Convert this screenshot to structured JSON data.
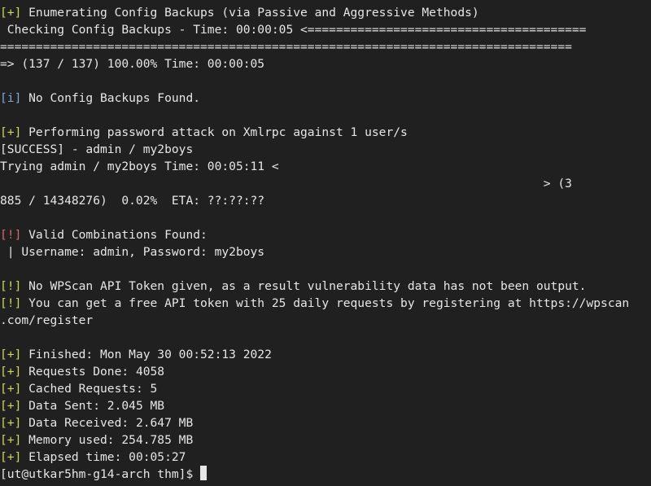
{
  "terminal": {
    "lines": [
      {
        "prefix": "[+]",
        "text": " Enumerating Config Backups (via Passive and Aggressive Methods)"
      },
      {
        "prefix": "",
        "text": " Checking Config Backups - Time: 00:00:05 <======================================="
      },
      {
        "prefix": "",
        "text": "================================================================================"
      },
      {
        "prefix": "",
        "text": "=> (137 / 137) 100.00% Time: 00:00:05"
      },
      {
        "prefix": "",
        "text": ""
      },
      {
        "prefix": "[i]",
        "text": " No Config Backups Found."
      },
      {
        "prefix": "",
        "text": ""
      },
      {
        "prefix": "[+]",
        "text": " Performing password attack on Xmlrpc against 1 user/s"
      },
      {
        "prefix": "",
        "text": "[SUCCESS] - admin / my2boys"
      },
      {
        "prefix": "",
        "text": "Trying admin / my2boys Time: 00:05:11 <"
      },
      {
        "prefix": "",
        "text": "                                                                            > (3"
      },
      {
        "prefix": "",
        "text": "885 / 14348276)  0.02%  ETA: ??:??:??"
      },
      {
        "prefix": "",
        "text": ""
      },
      {
        "prefix": "[!]",
        "text": " Valid Combinations Found:"
      },
      {
        "prefix": "",
        "text": " | Username: admin, Password: my2boys"
      },
      {
        "prefix": "",
        "text": ""
      },
      {
        "prefix": "[!]",
        "text": " No WPScan API Token given, as a result vulnerability data has not been output."
      },
      {
        "prefix": "[!]",
        "text": " You can get a free API token with 25 daily requests by registering at https://wpscan"
      },
      {
        "prefix": "",
        "text": ".com/register"
      },
      {
        "prefix": "",
        "text": ""
      },
      {
        "prefix": "[+]",
        "text": " Finished: Mon May 30 00:52:13 2022"
      },
      {
        "prefix": "[+]",
        "text": " Requests Done: 4058"
      },
      {
        "prefix": "[+]",
        "text": " Cached Requests: 5"
      },
      {
        "prefix": "[+]",
        "text": " Data Sent: 2.045 MB"
      },
      {
        "prefix": "[+]",
        "text": " Data Received: 2.647 MB"
      },
      {
        "prefix": "[+]",
        "text": " Memory used: 254.785 MB"
      },
      {
        "prefix": "[+]",
        "text": " Elapsed time: 00:05:27"
      }
    ],
    "prompt": "[ut@utkar5hm-g14-arch thm]$ "
  },
  "colors": {
    "background": "#202020",
    "foreground": "#e6e6e6",
    "plus_prefix": "#cfd65a",
    "info_prefix": "#7fa6d6",
    "error_prefix": "#d86a6a"
  }
}
